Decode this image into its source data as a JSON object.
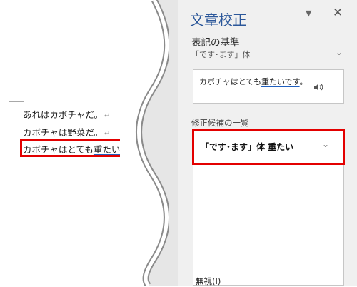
{
  "document": {
    "lines": [
      "あれはカボチャだ。",
      "カボチャは野菜だ。"
    ],
    "line3_prefix": "カボチャはとても",
    "line3_flag": "重たいです",
    "line3_suffix": "。",
    "para_mark": "↵"
  },
  "pane": {
    "title": "文章校正",
    "dropdown_icon": "caret-down",
    "close_icon": "close",
    "section_title": "表記の基準",
    "style_value": "「です･ます」体",
    "card_prefix": "カボチャはとても",
    "card_flag": "重たいです",
    "card_suffix": "。",
    "list_title": "修正候補の一覧",
    "candidate": "「です･ます」体 重たい",
    "ignore_label": "無視(I)"
  },
  "colors": {
    "highlight": "#e30000",
    "pane_title": "#2b579a",
    "underline": "#1f5fbf"
  }
}
